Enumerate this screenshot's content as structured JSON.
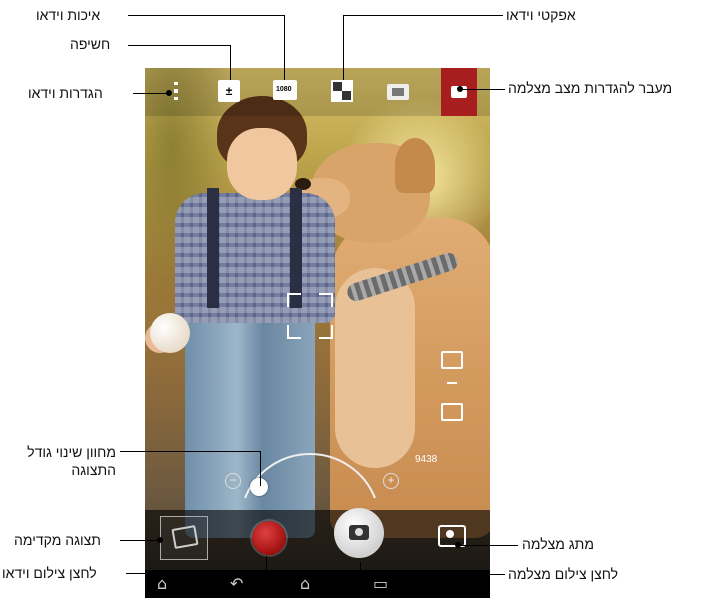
{
  "callouts": {
    "video_quality": "איכות וידאו",
    "video_effects": "אפקטי וידאו",
    "exposure": "חשיפה",
    "video_settings": "הגדרות וידאו",
    "switch_to_camera_settings": "מעבר להגדרות מצב מצלמה",
    "zoom_slider": "מחוון שינוי גודל התצוגה",
    "preview": "תצוגה מקדימה",
    "camera_toggle": "מתג מצלמה",
    "video_button": "לחצן צילום וידאו",
    "camera_button": "לחצן צילום מצלמה"
  },
  "screen": {
    "storage_count": "9438",
    "exposure_symbol": "±",
    "quality_label": "1080",
    "zoom_minus": "−",
    "zoom_plus": "+"
  },
  "navbar": {
    "home_top": "⌂",
    "back": "↶",
    "home": "⌂",
    "recent": "▭"
  },
  "colors": {
    "mode_switch": "#a81e1e",
    "record": "#c01818"
  }
}
